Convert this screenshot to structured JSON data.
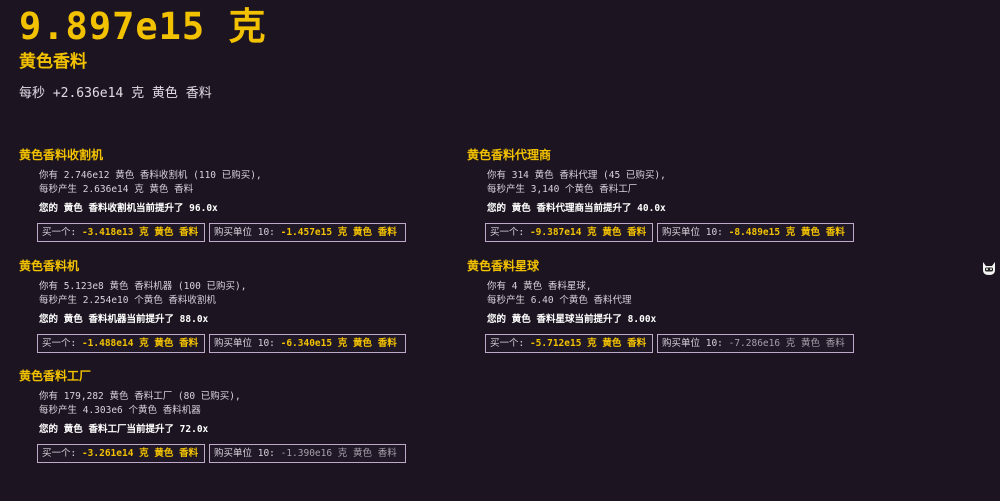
{
  "header": {
    "amount": "9.897e15 克",
    "currency_name": "黄色香料",
    "rate": "每秒 +2.636e14 克 黄色 香料"
  },
  "generators": [
    {
      "title": "黄色香料收割机",
      "line1": "你有 2.746e12 黄色 香料收割机 (110 已购买),",
      "line2": "每秒产生 2.636e14 克 黄色 香料",
      "boost": "您的 黄色 香料收割机当前提升了 96.0x",
      "buy1_label": "买一个: ",
      "buy1_cost": "-3.418e13 克 黄色 香料",
      "buy10_label": "购买单位 10: ",
      "buy10_cost": "-1.457e15 克 黄色 香料"
    },
    {
      "title": "黄色香料代理商",
      "line1": "你有 314 黄色 香料代理 (45 已购买),",
      "line2": "每秒产生 3,140 个黄色 香料工厂",
      "boost": "您的 黄色 香料代理商当前提升了 40.0x",
      "buy1_label": "买一个: ",
      "buy1_cost": "-9.387e14 克 黄色 香料",
      "buy10_label": "购买单位 10: ",
      "buy10_cost": "-8.489e15 克 黄色 香料"
    },
    {
      "title": "黄色香料机",
      "line1": "你有 5.123e8 黄色 香料机器 (100 已购买),",
      "line2": "每秒产生 2.254e10 个黄色 香料收割机",
      "boost": "您的 黄色 香料机器当前提升了 88.0x",
      "buy1_label": "买一个: ",
      "buy1_cost": "-1.488e14 克 黄色 香料",
      "buy10_label": "购买单位 10: ",
      "buy10_cost": "-6.340e15 克 黄色 香料"
    },
    {
      "title": "黄色香料星球",
      "line1": "你有 4 黄色 香料星球,",
      "line2": "每秒产生 6.40 个黄色 香料代理",
      "boost": "您的 黄色 香料星球当前提升了 8.00x",
      "buy1_label": "买一个: ",
      "buy1_cost": "-5.712e15 克 黄色 香料",
      "buy10_label": "购买单位 10: ",
      "buy10_cost": "-7.286e16 克 黄色 香料"
    },
    {
      "title": "黄色香料工厂",
      "line1": "你有 179,282 黄色 香料工厂 (80 已购买),",
      "line2": "每秒产生 4.303e6 个黄色 香料机器",
      "boost": "您的 黄色 香料工厂当前提升了 72.0x",
      "buy1_label": "买一个: ",
      "buy1_cost": "-3.261e14 克 黄色 香料",
      "buy10_label": "购买单位 10: ",
      "buy10_cost": "-1.390e16 克 黄色 香料"
    }
  ],
  "colors": {
    "background": "#1c1420",
    "accent": "#f2c100",
    "button_border": "#bfa9c9",
    "disabled_cost": "#a79fab"
  },
  "side_icon": "cat-icon"
}
